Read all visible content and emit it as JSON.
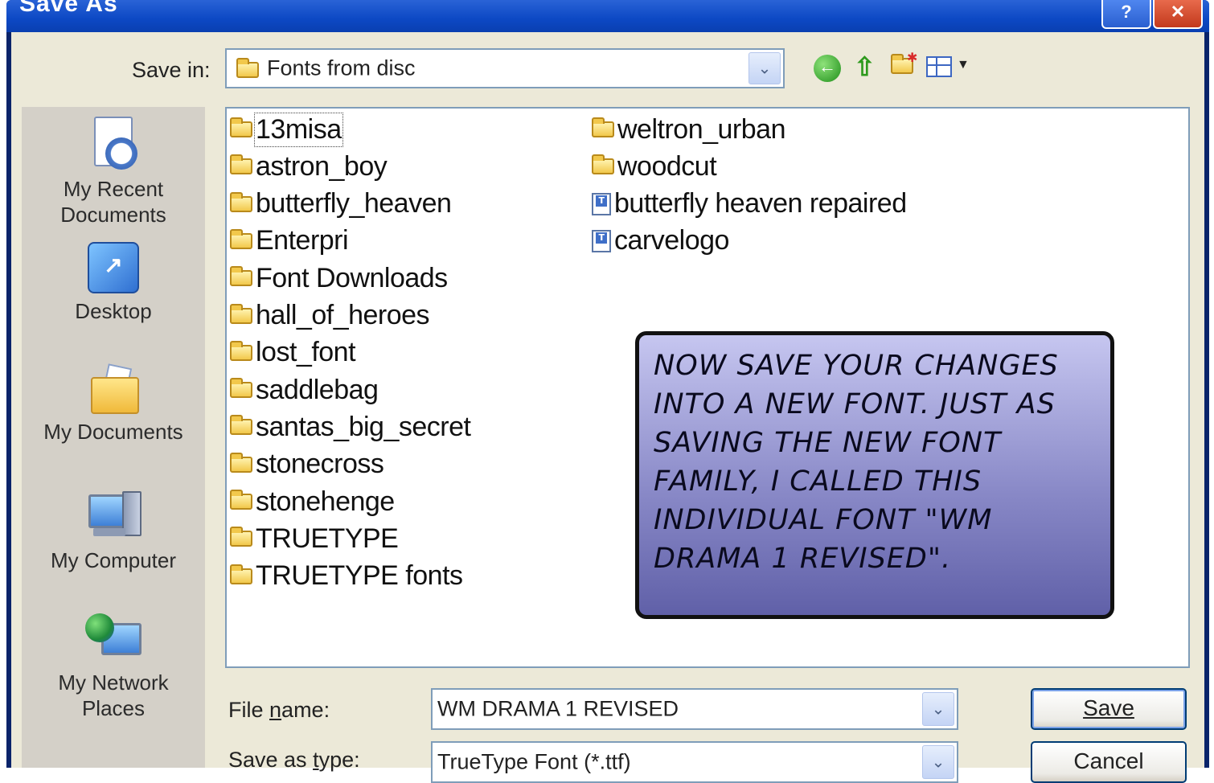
{
  "window": {
    "title": "Save As"
  },
  "toolbar": {
    "save_in_label": "Save in:",
    "save_in_value": "Fonts from disc",
    "icons": [
      "back-icon",
      "up-folder-icon",
      "new-folder-icon",
      "views-menu-icon"
    ]
  },
  "places": [
    {
      "label": "My Recent Documents",
      "icon": "recent-documents-icon"
    },
    {
      "label": "Desktop",
      "icon": "desktop-icon"
    },
    {
      "label": "My Documents",
      "icon": "my-documents-icon"
    },
    {
      "label": "My Computer",
      "icon": "my-computer-icon"
    },
    {
      "label": "My Network Places",
      "icon": "network-places-icon"
    }
  ],
  "files": {
    "column1": [
      {
        "name": "13misa",
        "type": "folder",
        "selected": true
      },
      {
        "name": "astron_boy",
        "type": "folder"
      },
      {
        "name": "butterfly_heaven",
        "type": "folder"
      },
      {
        "name": "Enterpri",
        "type": "folder"
      },
      {
        "name": "Font Downloads",
        "type": "folder"
      },
      {
        "name": "hall_of_heroes",
        "type": "folder"
      },
      {
        "name": "lost_font",
        "type": "folder"
      },
      {
        "name": "saddlebag",
        "type": "folder"
      },
      {
        "name": "santas_big_secret",
        "type": "folder"
      },
      {
        "name": "stonecross",
        "type": "folder"
      },
      {
        "name": "stonehenge",
        "type": "folder"
      },
      {
        "name": "TRUETYPE",
        "type": "folder"
      },
      {
        "name": "TRUETYPE fonts",
        "type": "folder"
      }
    ],
    "column2": [
      {
        "name": "weltron_urban",
        "type": "folder"
      },
      {
        "name": "woodcut",
        "type": "folder"
      },
      {
        "name": "butterfly heaven repaired",
        "type": "truetype-file"
      },
      {
        "name": "carvelogo",
        "type": "truetype-file"
      }
    ]
  },
  "callout": {
    "text": "Now save your changes into a new font. Just as saving the new font family, I called this individual font \"WM Drama 1 Revised\"."
  },
  "form": {
    "file_name_label": "File name:",
    "file_name_value": "WM DRAMA 1 REVISED",
    "save_type_label": "Save as type:",
    "save_type_value": "TrueType Font (*.ttf)"
  },
  "buttons": {
    "save": "Save",
    "cancel": "Cancel"
  },
  "colors": {
    "titlebar": "#0c48c4",
    "dialog_bg": "#ece9d8",
    "callout_bg": "#8a8ac8",
    "list_border": "#7f9db9"
  }
}
